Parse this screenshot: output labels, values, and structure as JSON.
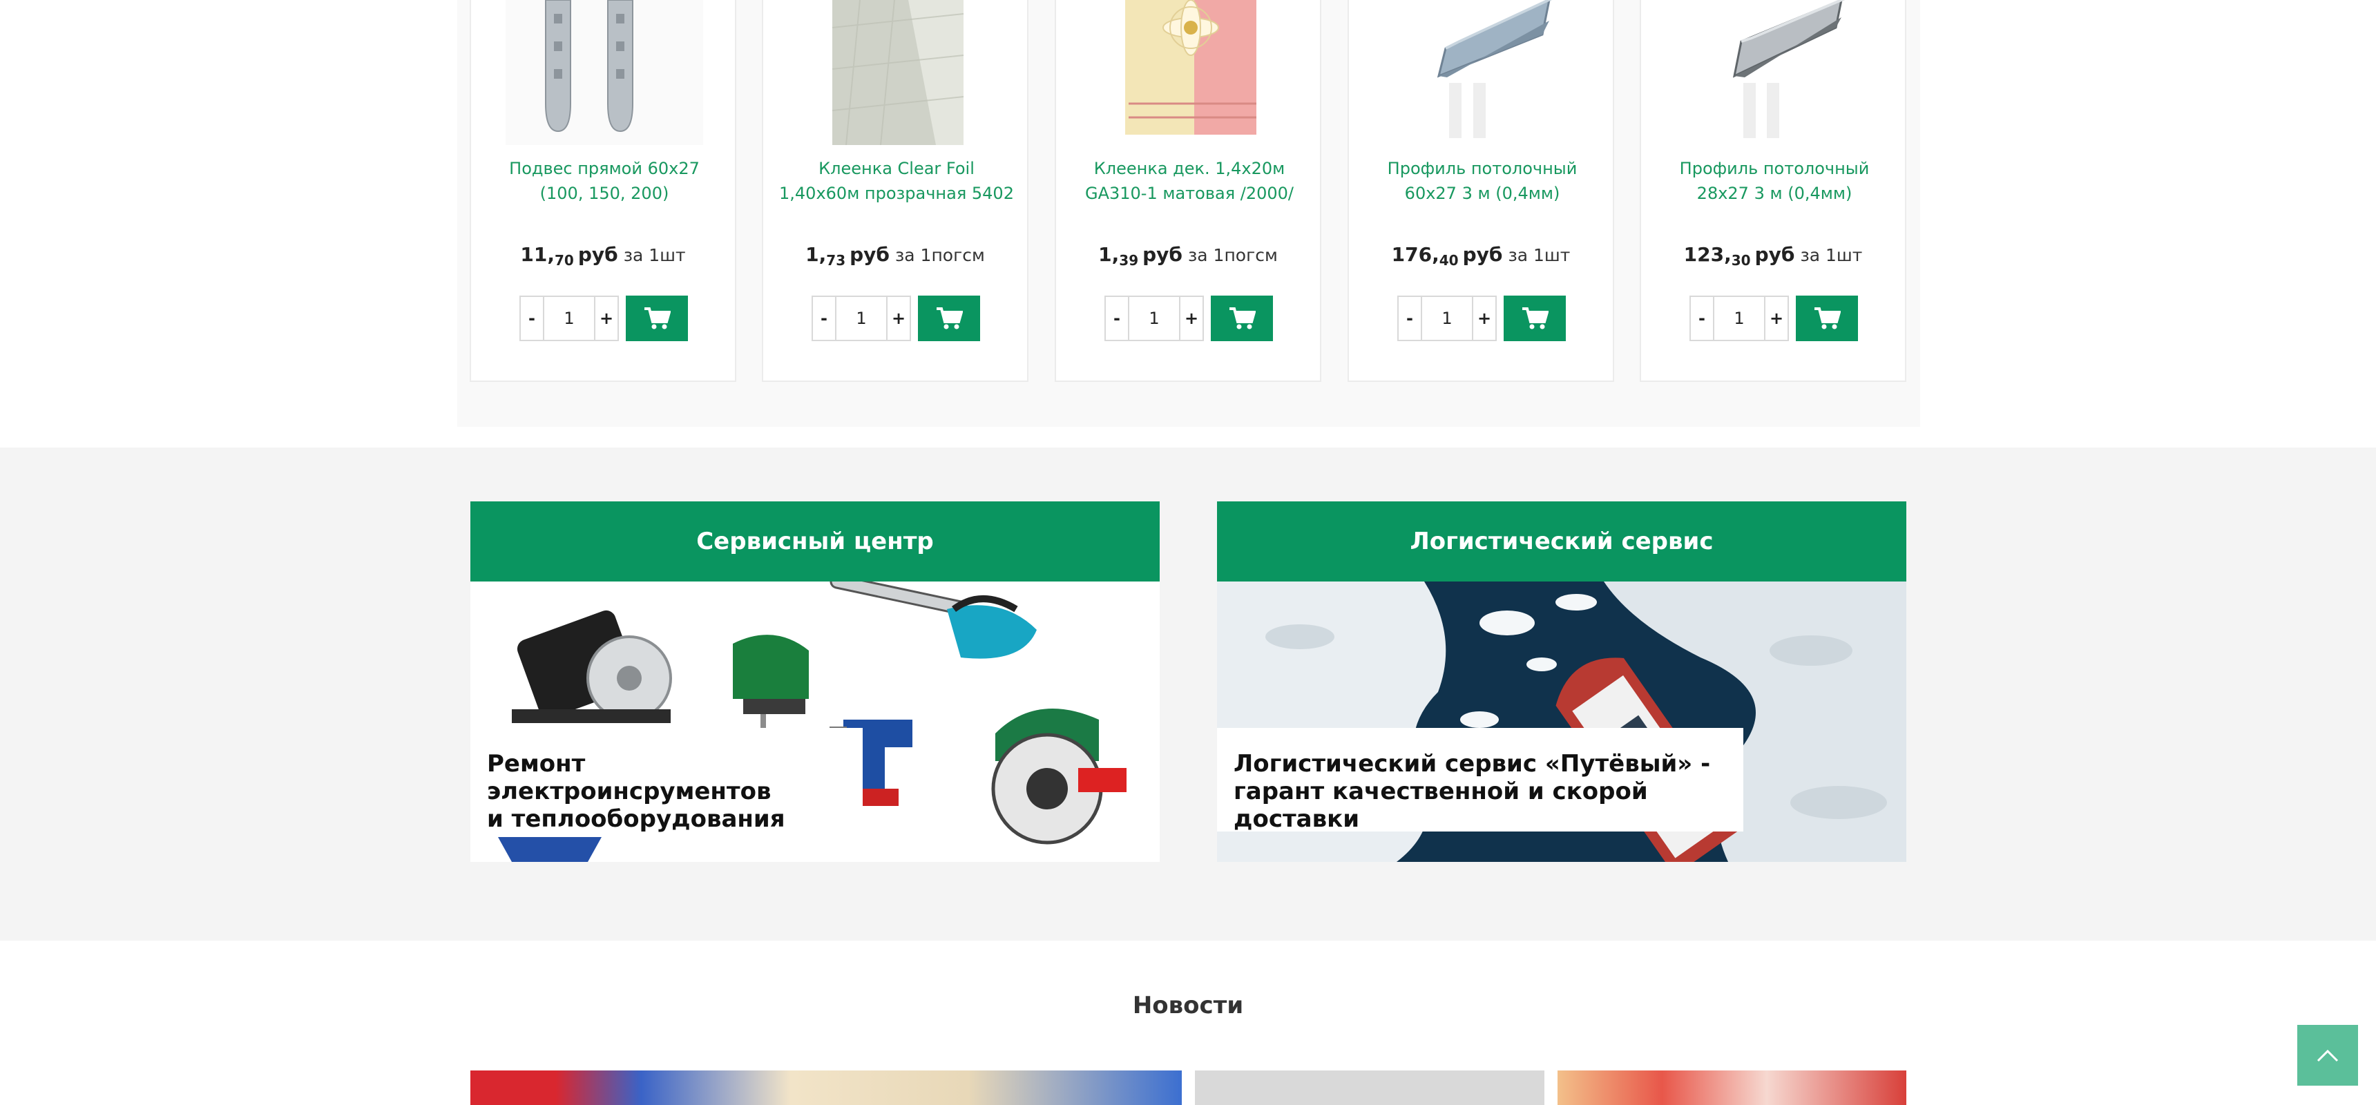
{
  "products": [
    {
      "title": "Подвес прямой 60х27 (100, 150, 200)",
      "price_int": "11,",
      "price_cents": "70",
      "currency": "руб",
      "per": "за 1шт",
      "qty": "1"
    },
    {
      "title": "Клеенка Clear Foil 1,40х60м прозрачная 5402",
      "price_int": "1,",
      "price_cents": "73",
      "currency": "руб",
      "per": "за 1погсм",
      "qty": "1"
    },
    {
      "title": "Клеенка дек. 1,4х20м GA310-1 матовая /2000/",
      "price_int": "1,",
      "price_cents": "39",
      "currency": "руб",
      "per": "за 1погсм",
      "qty": "1"
    },
    {
      "title": "Профиль потолочный 60х27 3 м (0,4мм)",
      "price_int": "176,",
      "price_cents": "40",
      "currency": "руб",
      "per": "за 1шт",
      "qty": "1"
    },
    {
      "title": "Профиль потолочный 28х27 3 м (0,4мм)",
      "price_int": "123,",
      "price_cents": "30",
      "currency": "руб",
      "per": "за 1шт",
      "qty": "1"
    }
  ],
  "qty_controls": {
    "minus": "-",
    "plus": "+"
  },
  "services": [
    {
      "heading": "Сервисный центр",
      "caption_line1": "Ремонт электроинсрументов",
      "caption_line2": "и теплооборудования"
    },
    {
      "heading": "Логистический сервис",
      "caption_line1": "Логистический сервис «Путёвый» -",
      "caption_line2": "гарант качественной и скорой доставки"
    }
  ],
  "news": {
    "title": "Новости"
  },
  "colors": {
    "brand_green": "#0a9560",
    "link_green": "#18985f",
    "back_to_top": "#5bbf9a"
  },
  "icons": {
    "cart": "cart-icon",
    "back_to_top": "chevron-up-icon"
  }
}
